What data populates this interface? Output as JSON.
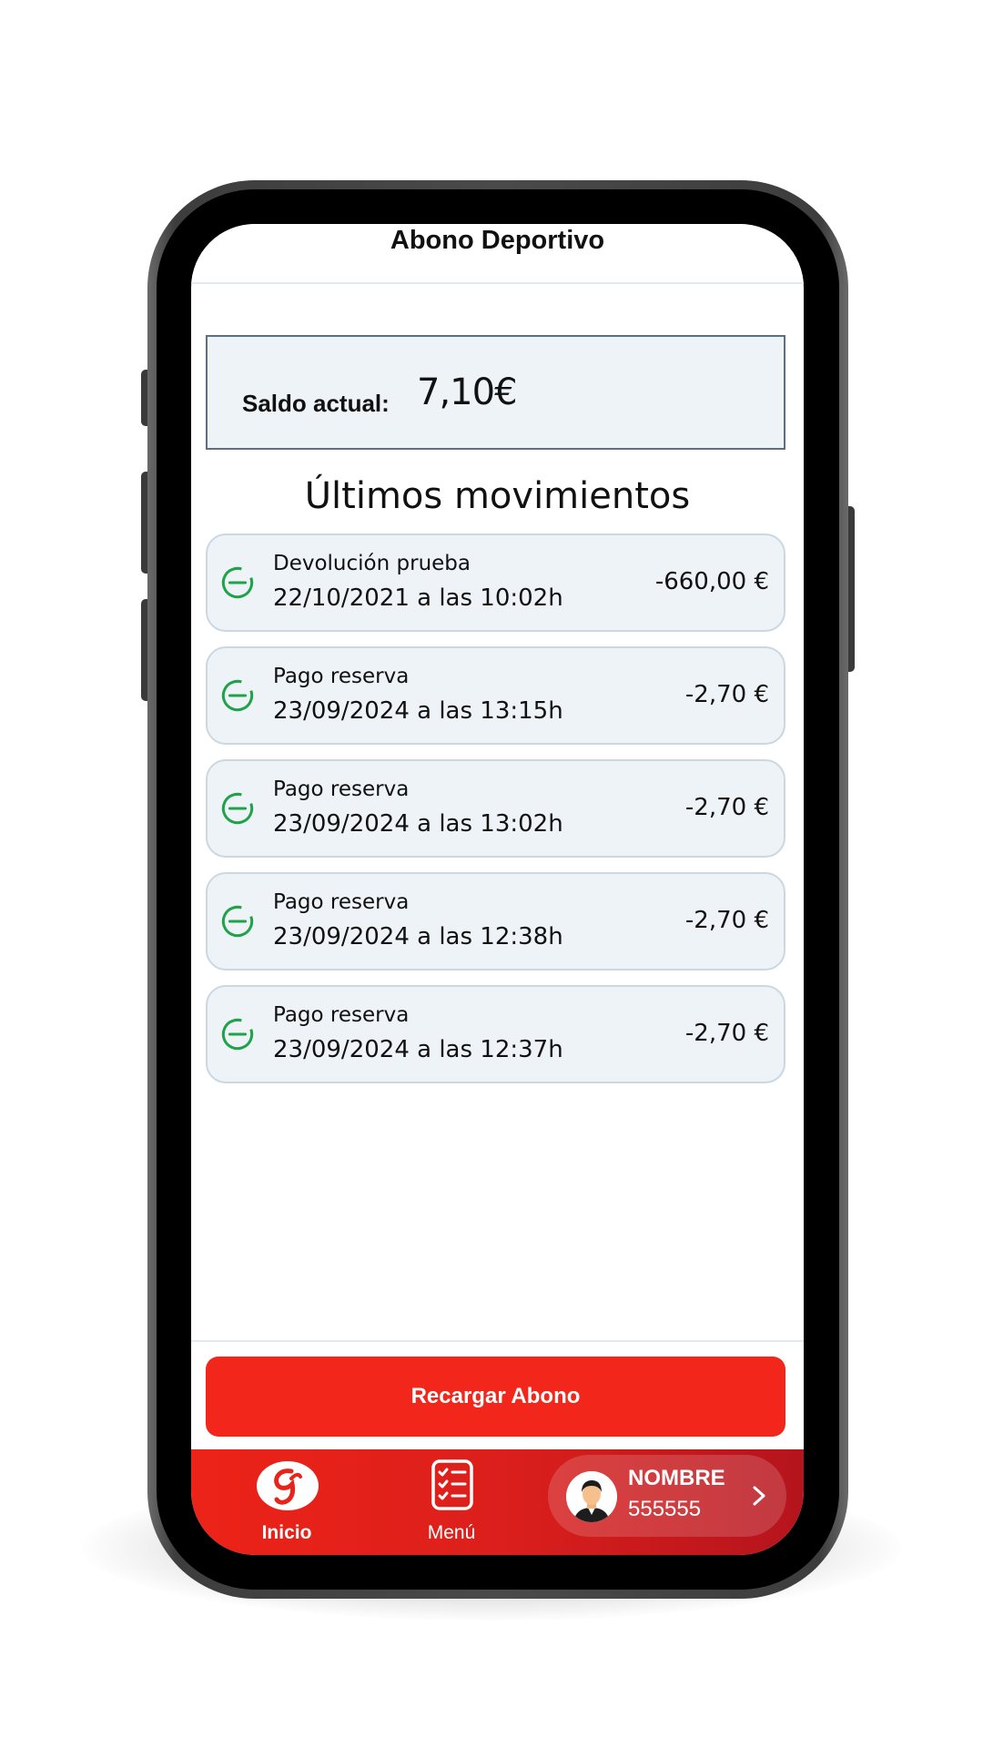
{
  "header": {
    "title": "Abono Deportivo"
  },
  "balance": {
    "label": "Saldo actual:",
    "value": "7,10€"
  },
  "movements_section": {
    "title": "Últimos movimientos",
    "items": [
      {
        "description": "Devolución prueba",
        "date": "22/10/2021 a las 10:02h",
        "amount": "-660,00 €",
        "icon": "minus-circle-icon"
      },
      {
        "description": "Pago reserva",
        "date": "23/09/2024 a las 13:15h",
        "amount": "-2,70 €",
        "icon": "minus-circle-icon"
      },
      {
        "description": "Pago reserva",
        "date": "23/09/2024 a las 13:02h",
        "amount": "-2,70 €",
        "icon": "minus-circle-icon"
      },
      {
        "description": "Pago reserva",
        "date": "23/09/2024 a las 12:38h",
        "amount": "-2,70 €",
        "icon": "minus-circle-icon"
      },
      {
        "description": "Pago reserva",
        "date": "23/09/2024 a las 12:37h",
        "amount": "-2,70 €",
        "icon": "minus-circle-icon"
      }
    ]
  },
  "actions": {
    "recharge_label": "Recargar Abono"
  },
  "bottom_nav": {
    "home_label": "Inicio",
    "menu_label": "Menú",
    "profile_name": "NOMBRE",
    "profile_id": "555555"
  },
  "colors": {
    "accent_red": "#f2261a",
    "icon_green": "#1fa24a",
    "card_background": "#eef3f7"
  }
}
